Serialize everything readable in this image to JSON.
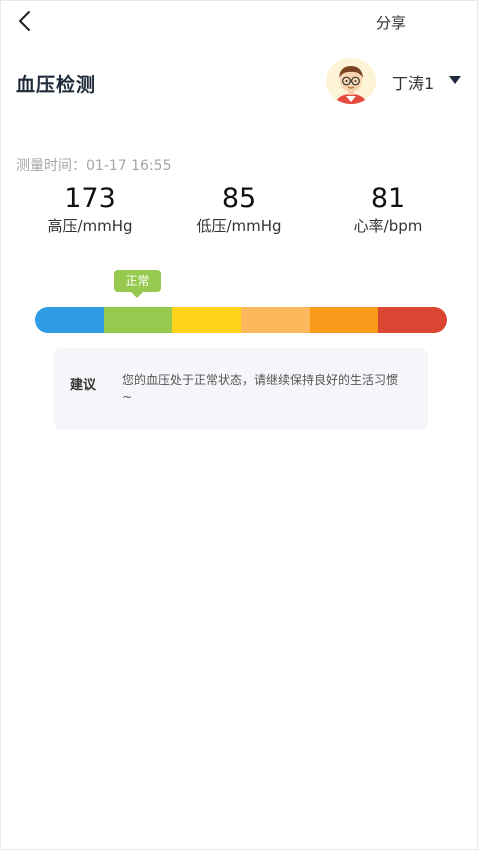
{
  "nav": {
    "back_icon": "chevron-left-icon",
    "share_label": "分享"
  },
  "header": {
    "title": "血压检测",
    "user_name": "丁涛1",
    "avatar_icon": "avatar-boy-with-glasses",
    "caret_icon": "caret-down-icon"
  },
  "measurement": {
    "time": "测量时间：01-17 16:55",
    "readings": [
      {
        "value": "173",
        "label": "高压/mmHg"
      },
      {
        "value": "85",
        "label": "低压/mmHg"
      },
      {
        "value": "81",
        "label": "心率/bpm"
      }
    ]
  },
  "status": {
    "label": "正常",
    "color": "#96c94e",
    "segment_colors": [
      "#2e9be3",
      "#96c94e",
      "#fdd31c",
      "#fdb85e",
      "#f89b1b",
      "#db4632"
    ]
  },
  "advice": {
    "label": "建议",
    "text": "您的血压处于正常状态，请继续保持良好的生活习惯~"
  }
}
